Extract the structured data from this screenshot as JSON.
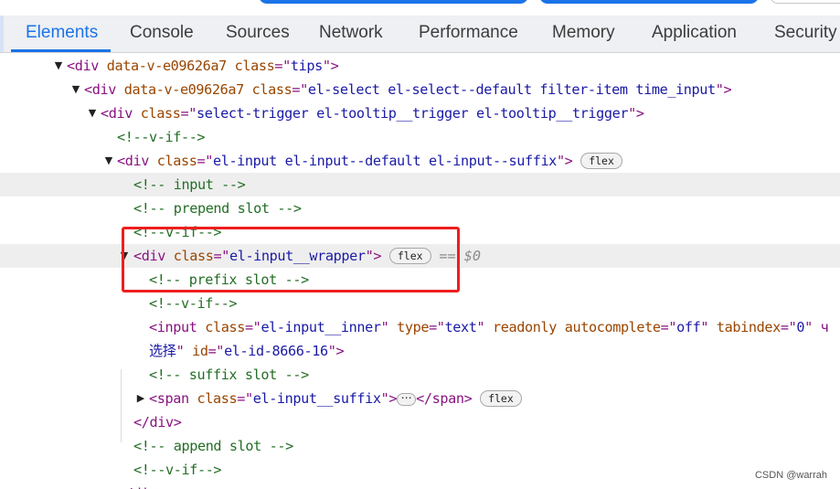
{
  "tabs": [
    "Elements",
    "Console",
    "Sources",
    "Network",
    "Performance",
    "Memory",
    "Application",
    "Security"
  ],
  "active_tab": "Elements",
  "tree": {
    "r1": {
      "open": "<",
      "tag": "div",
      "a1": "data-v-e09626a7",
      "a2": " class",
      "eq": "=\"",
      "v": "tips",
      "close": "\">"
    },
    "r2": {
      "open": "<",
      "tag": "div",
      "a1": "data-v-e09626a7",
      "a2": " class",
      "eq": "=\"",
      "v": "el-select el-select--default filter-item time_input",
      "close": "\">"
    },
    "r3": {
      "open": "<",
      "tag": "div",
      "a1": "class",
      "eq": "=\"",
      "v": "select-trigger el-tooltip__trigger el-tooltip__trigger",
      "close": "\">"
    },
    "r4": {
      "comment": "<!--v-if-->"
    },
    "r5": {
      "open": "<",
      "tag": "div",
      "a1": "class",
      "eq": "=\"",
      "v": "el-input el-input--default el-input--suffix",
      "close": "\">",
      "badge": "flex"
    },
    "r6": {
      "comment": "<!-- input -->"
    },
    "r7": {
      "comment": "<!-- prepend slot -->"
    },
    "r8": {
      "comment": "<!--v-if-->"
    },
    "r9": {
      "open": "<",
      "tag": "div",
      "a1": "class",
      "eq": "=\"",
      "v": "el-input__wrapper",
      "close": "\">",
      "badge": "flex",
      "selected": "== $0"
    },
    "r10": {
      "comment": "<!-- prefix slot -->"
    },
    "r11": {
      "comment": "<!--v-if-->"
    },
    "r12": {
      "open": "<",
      "tag": "input",
      "a1": "class",
      "eq": "=\"",
      "v": "el-input__inner",
      "q": "\"",
      "a2": " type",
      "eq2": "=\"",
      "v2": "text",
      "q2": "\"",
      "a3": " readonly autocomplete",
      "eq3": "=\"",
      "v3": "off",
      "q3": "\"",
      "a4": " tabindex",
      "eq4": "=\"",
      "v4": "0",
      "q4": "\" ч"
    },
    "r13": {
      "v": "选择",
      "q": "\"",
      "a1": " id",
      "eq": "=\"",
      "v2": "el-id-8666-16",
      "close": "\">"
    },
    "r14": {
      "comment": "<!-- suffix slot -->"
    },
    "r15": {
      "open": "<",
      "tag": "span",
      "a1": "class",
      "eq": "=\"",
      "v": "el-input__suffix",
      "close": "\">",
      "end": "</span>",
      "badge": "flex"
    },
    "r16": {
      "endtag": "</div>"
    },
    "r17": {
      "comment": "<!-- append slot -->"
    },
    "r18": {
      "comment": "<!--v-if-->"
    },
    "r19": {
      "endtag": "</div>"
    }
  },
  "watermark": "CSDN @warrah"
}
